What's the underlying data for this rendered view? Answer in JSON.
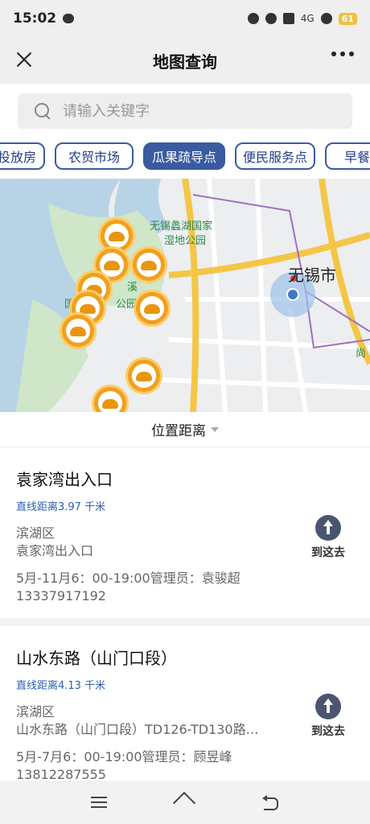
{
  "status": {
    "time": "15:02",
    "network": "4G",
    "battery": "61"
  },
  "header": {
    "title": "地图查询"
  },
  "search": {
    "placeholder": "请输入关键字"
  },
  "categories": [
    {
      "label": "投放房",
      "active": false
    },
    {
      "label": "农贸市场",
      "active": false
    },
    {
      "label": "瓜果疏导点",
      "active": true
    },
    {
      "label": "便民服务点",
      "active": false
    },
    {
      "label": "早餐",
      "active": false
    }
  ],
  "map": {
    "park_label_line1": "无锡蠡湖国家",
    "park_label_line2": "湿地公园",
    "city_label": "无锡市",
    "poi_partial_1": "溪",
    "poi_partial_2": "国",
    "poi_partial_3": "公园",
    "poi_partial_right": "尚",
    "colors": {
      "water": "#b7d4e6",
      "park": "#cfe6c9",
      "road_major": "#f4c646",
      "road": "#ffffff",
      "accent": "#3a5ba0",
      "pin": "#f0a020"
    }
  },
  "sort": {
    "label": "位置距离"
  },
  "list": [
    {
      "name": "袁家湾出入口",
      "distance": "直线距离3.97 千米",
      "district": "滨湖区",
      "address": "袁家湾出入口",
      "hours": "5月-11月6：00-19:00管理员：袁骏超",
      "phone": "13337917192",
      "action": "到这去"
    },
    {
      "name": "山水东路（山门口段）",
      "distance": "直线距离4.13 千米",
      "district": "滨湖区",
      "address": "山水东路（山门口段）TD126-TD130路…",
      "hours": "5月-7月6：00-19:00管理员：顾昱峰",
      "phone": "13812287555",
      "action": "到这去"
    }
  ]
}
